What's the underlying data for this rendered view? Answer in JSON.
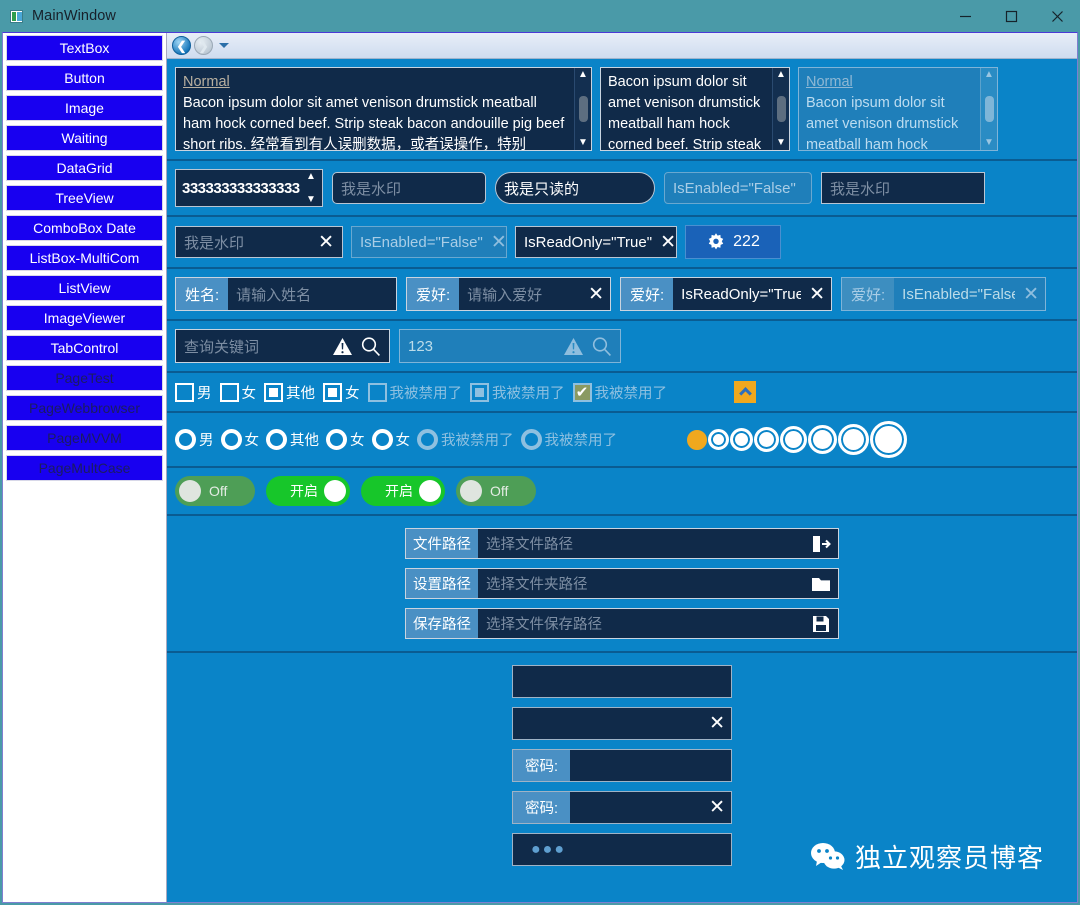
{
  "window": {
    "title": "MainWindow",
    "minimize_label": "Minimize",
    "maximize_label": "Maximize",
    "close_label": "Close",
    "titlebar_color": "#4a9aa8",
    "accent_color": "#0a84c8"
  },
  "sidebar": {
    "items": [
      {
        "label": "TextBox",
        "enabled": true
      },
      {
        "label": "Button",
        "enabled": true
      },
      {
        "label": "Image",
        "enabled": true
      },
      {
        "label": "Waiting",
        "enabled": true
      },
      {
        "label": "DataGrid",
        "enabled": true
      },
      {
        "label": "TreeView",
        "enabled": true
      },
      {
        "label": "ComboBox Date",
        "enabled": true
      },
      {
        "label": "ListBox-MultiCom",
        "enabled": true
      },
      {
        "label": "ListView",
        "enabled": true
      },
      {
        "label": "ImageViewer",
        "enabled": true
      },
      {
        "label": "TabControl",
        "enabled": true
      },
      {
        "label": "PageTest",
        "enabled": false
      },
      {
        "label": "PageWebbrowser",
        "enabled": false
      },
      {
        "label": "PageMVVM",
        "enabled": false
      },
      {
        "label": "PageMultCase",
        "enabled": false
      }
    ]
  },
  "navbar": {
    "back_icon": "back-arrow-icon",
    "forward_icon": "forward-arrow-icon",
    "dropdown_icon": "chevron-down-icon"
  },
  "multiline_row": {
    "boxes": [
      {
        "header": "Normal",
        "text": "Bacon ipsum dolor sit amet venison drumstick meatball ham hock corned beef. Strip steak bacon andouille pig beef short ribs. 经常看到有人误删数据，或者误操作，特别",
        "disabled": false,
        "has_header": true
      },
      {
        "header": "",
        "text": "Bacon ipsum dolor sit amet venison drumstick meatball ham hock corned beef. Strip steak",
        "disabled": false,
        "has_header": false
      },
      {
        "header": "Normal",
        "text": "Bacon ipsum dolor sit amet venison drumstick meatball ham hock",
        "disabled": true,
        "has_header": true
      }
    ]
  },
  "input_row": {
    "numeric_value": "333333333333333",
    "watermark_1": "我是水印",
    "readonly_text": "我是只读的",
    "disabled_text": "IsEnabled=\"False\"",
    "watermark_2": "我是水印"
  },
  "clear_row": {
    "field1": "我是水印",
    "field2": "IsEnabled=\"False\"",
    "field3": "IsReadOnly=\"True\"",
    "gear_button": {
      "icon": "gear-icon",
      "label": "222"
    },
    "clear_icon": "close-icon"
  },
  "labeled_row": {
    "fields": [
      {
        "label": "姓名:",
        "value": "请输入姓名",
        "filled": false,
        "clear": false,
        "disabled": false
      },
      {
        "label": "爱好:",
        "value": "请输入爱好",
        "filled": false,
        "clear": true,
        "disabled": false
      },
      {
        "label": "爱好:",
        "value": "IsReadOnly=\"True\"",
        "filled": true,
        "clear": true,
        "disabled": false
      },
      {
        "label": "爱好:",
        "value": "IsEnabled=\"False\"",
        "filled": true,
        "clear": true,
        "disabled": true
      }
    ]
  },
  "search_row": {
    "fields": [
      {
        "value": "查询关键词",
        "disabled": false
      },
      {
        "value": "123",
        "disabled": true
      }
    ],
    "warning_icon": "warning-triangle-icon",
    "search_icon": "search-icon"
  },
  "checkbox_row": {
    "items": [
      {
        "label": "男",
        "state": "unchecked",
        "disabled": false
      },
      {
        "label": "女",
        "state": "unchecked",
        "disabled": false
      },
      {
        "label": "其他",
        "state": "indeterminate",
        "disabled": false
      },
      {
        "label": "女",
        "state": "indeterminate",
        "disabled": false
      },
      {
        "label": "我被禁用了",
        "state": "unchecked",
        "disabled": true
      },
      {
        "label": "我被禁用了",
        "state": "indeterminate",
        "disabled": true
      },
      {
        "label": "我被禁用了",
        "state": "checked",
        "disabled": true
      }
    ],
    "overlap_text": "我被禁用了",
    "expander_icon": "chevron-up-icon",
    "expander_color": "#f0a81e"
  },
  "radio_row": {
    "items": [
      {
        "label": "男",
        "disabled": false
      },
      {
        "label": "女",
        "disabled": false
      },
      {
        "label": "其他",
        "disabled": false
      },
      {
        "label": "女",
        "disabled": false
      },
      {
        "label": "女",
        "disabled": false
      },
      {
        "label": "我被禁用了",
        "disabled": true
      },
      {
        "label": "我被禁用了",
        "disabled": true
      }
    ],
    "overlap_text": "我被禁用了",
    "sizes": [
      20,
      21,
      23,
      25,
      27,
      29,
      31,
      37
    ],
    "first_color": "#f0a81e"
  },
  "toggle_row": {
    "items": [
      {
        "label": "Off",
        "on": false
      },
      {
        "label": "开启",
        "on": true
      },
      {
        "label": "开启",
        "on": true
      },
      {
        "label": "Off",
        "on": false
      }
    ]
  },
  "path_row": {
    "items": [
      {
        "label": "文件路径",
        "placeholder": "选择文件路径",
        "icon": "open-file-icon"
      },
      {
        "label": "设置路径",
        "placeholder": "选择文件夹路径",
        "icon": "folder-icon"
      },
      {
        "label": "保存路径",
        "placeholder": "选择文件保存路径",
        "icon": "save-disk-icon"
      }
    ]
  },
  "password_row": {
    "items": [
      {
        "label": "",
        "value": "",
        "clear": false,
        "dots": false
      },
      {
        "label": "",
        "value": "",
        "clear": true,
        "dots": false
      },
      {
        "label": "密码:",
        "value": "",
        "clear": false,
        "dots": false
      },
      {
        "label": "密码:",
        "value": "",
        "clear": true,
        "dots": false
      },
      {
        "label": "",
        "value": "",
        "clear": false,
        "dots": true
      }
    ],
    "dots_text": "●●●",
    "clear_icon": "close-icon"
  },
  "watermark": {
    "text": "独立观察员博客",
    "icon": "wechat-icon"
  }
}
